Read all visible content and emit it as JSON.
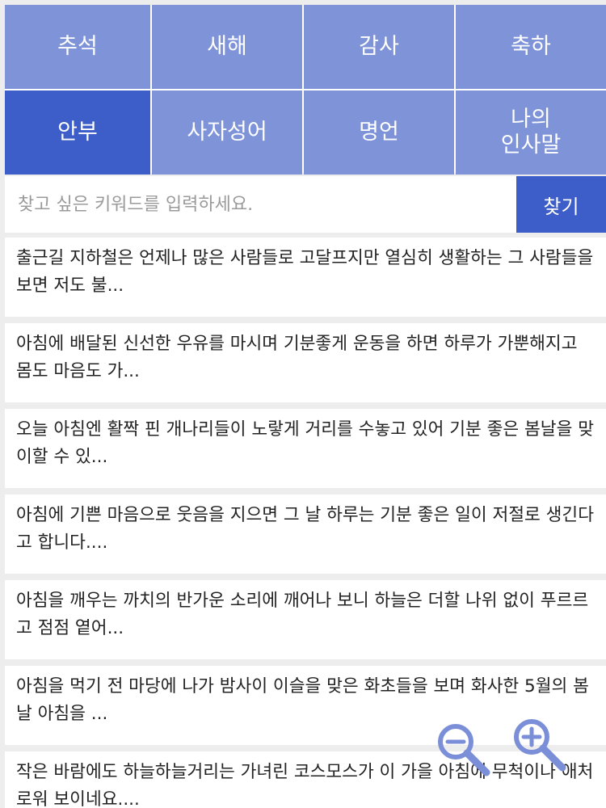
{
  "categories": [
    {
      "label": "추석"
    },
    {
      "label": "새해"
    },
    {
      "label": "감사"
    },
    {
      "label": "축하"
    },
    {
      "label": "안부"
    },
    {
      "label": "사자성어"
    },
    {
      "label": "명언"
    },
    {
      "label": "나의\n인사말"
    }
  ],
  "search": {
    "placeholder": "찾고 싶은 키워드를 입력하세요.",
    "button_label": "찾기"
  },
  "messages": [
    {
      "text": "출근길 지하철은 언제나 많은 사람들로 고달프지만 열심히 생활하는 그 사람들을 보면 저도 불..."
    },
    {
      "text": "아침에 배달된 신선한 우유를 마시며 기분좋게 운동을 하면 하루가 가뿐해지고 몸도 마음도 가..."
    },
    {
      "text": "오늘 아침엔 활짝 핀 개나리들이 노랗게 거리를 수놓고 있어 기분 좋은 봄날을 맞이할 수 있..."
    },
    {
      "text": "아침에 기쁜 마음으로 웃음을 지으면 그 날 하루는 기분 좋은 일이 저절로 생긴다고 합니다...."
    },
    {
      "text": "아침을 깨우는 까치의 반가운 소리에 깨어나 보니 하늘은 더할 나위 없이 푸르르고 점점 옅어..."
    },
    {
      "text": "아침을 먹기 전 마당에 나가 밤사이 이슬을 맞은 화초들을 보며 화사한 5월의 봄날 아침을 ..."
    },
    {
      "text": "작은 바람에도 하늘하늘거리는 가녀린 코스모스가 이 가을 아침에 무척이나 애처로워 보이네요...."
    }
  ],
  "colors": {
    "tab_inactive": "#7e93d8",
    "tab_active": "#3d5dc8",
    "zoom_icon": "#7b8fd8"
  },
  "icons": {
    "zoom_out": "zoom-out-icon",
    "zoom_in": "zoom-in-icon"
  }
}
